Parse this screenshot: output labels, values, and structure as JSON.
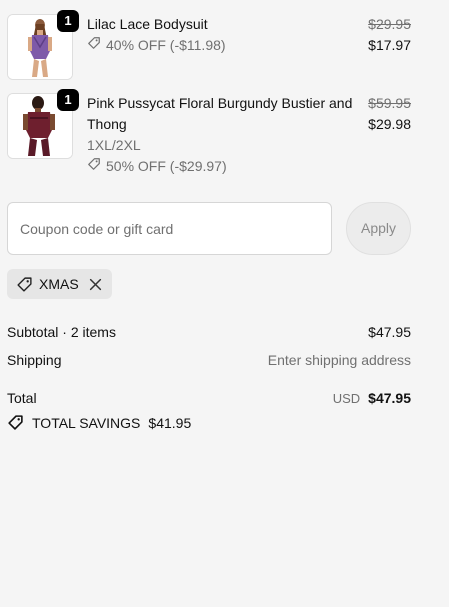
{
  "items": [
    {
      "name": "Lilac Lace Bodysuit",
      "variant": "",
      "quantity": "1",
      "discount": "40% OFF (-$11.98)",
      "original_price": "$29.95",
      "final_price": "$17.97"
    },
    {
      "name": "Pink Pussycat Floral Burgundy Bustier and Thong",
      "variant": "1XL/2XL",
      "quantity": "1",
      "discount": "50% OFF (-$29.97)",
      "original_price": "$59.95",
      "final_price": "$29.98"
    }
  ],
  "coupon": {
    "placeholder": "Coupon code or gift card",
    "apply_label": "Apply",
    "applied_code": "XMAS"
  },
  "summary": {
    "subtotal_label": "Subtotal · 2 items",
    "subtotal_value": "$47.95",
    "shipping_label": "Shipping",
    "shipping_value": "Enter shipping address",
    "total_label": "Total",
    "currency": "USD",
    "total_value": "$47.95",
    "savings_label": "TOTAL SAVINGS",
    "savings_value": "$41.95"
  },
  "colors": {
    "background": "#f5f5f5",
    "text": "#111111",
    "muted": "#707070",
    "badge": "#000000"
  },
  "icons": [
    "tag-icon",
    "close-icon"
  ]
}
